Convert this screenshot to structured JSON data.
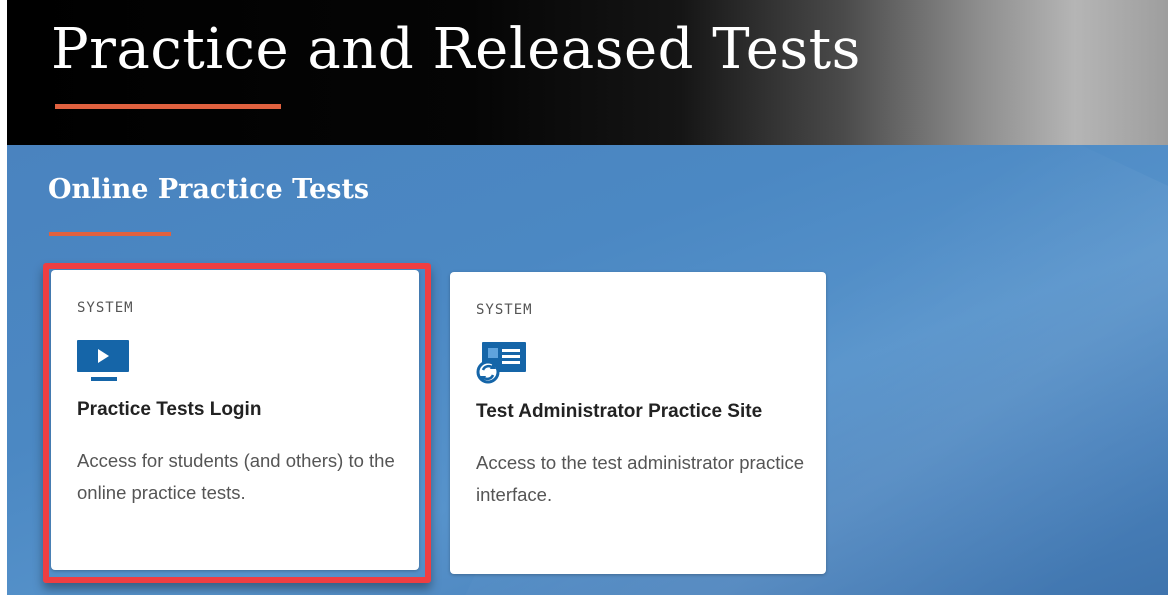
{
  "header": {
    "title": "Practice and Released Tests"
  },
  "section": {
    "title": "Online Practice Tests"
  },
  "cards": [
    {
      "eyebrow": "SYSTEM",
      "icon": "monitor-play-icon",
      "title": "Practice Tests Login",
      "description": "Access for students (and others) to the online practice tests.",
      "highlighted": true
    },
    {
      "eyebrow": "SYSTEM",
      "icon": "admin-document-sync-icon",
      "title": "Test Administrator Practice Site",
      "description": "Access to the test administrator practice interface.",
      "highlighted": false
    }
  ],
  "colors": {
    "accent": "#e0613f",
    "highlight": "#ef3e42",
    "icon_blue": "#1565a8",
    "content_blue": "#4b88c3"
  }
}
